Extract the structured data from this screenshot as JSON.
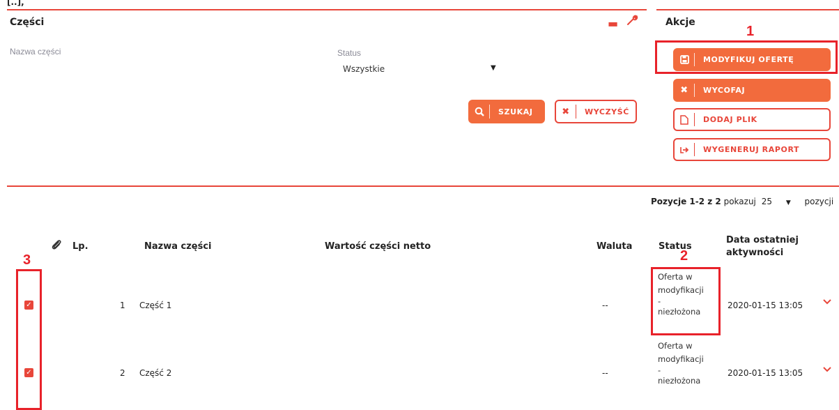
{
  "top_fragment": "[..],",
  "parts_panel": {
    "title": "Części",
    "field_name_label": "Nazwa części",
    "field_status_label": "Status",
    "status_selected": "Wszystkie",
    "search_label": "SZUKAJ",
    "clear_label": "WYCZYŚĆ"
  },
  "actions_panel": {
    "title": "Akcje",
    "buttons": [
      {
        "label": "MODYFIKUJ OFERTĘ",
        "icon": "save-icon"
      },
      {
        "label": "WYCOFAJ",
        "icon": "close-icon"
      },
      {
        "label": "DODAJ PLIK",
        "icon": "file-icon"
      },
      {
        "label": "WYGENERUJ RAPORT",
        "icon": "export-icon"
      }
    ]
  },
  "annotations": {
    "a1": "1",
    "a2": "2",
    "a3": "3"
  },
  "pagination": {
    "range_prefix": "Pozycje 1-2 z 2",
    "show_label": "pokazuj",
    "page_size": "25",
    "suffix": "pozycji"
  },
  "table": {
    "headers": {
      "lp": "Lp.",
      "name": "Nazwa części",
      "value": "Wartość części netto",
      "currency": "Waluta",
      "status": "Status",
      "date_line1": "Data ostatniej",
      "date_line2": "aktywności"
    },
    "rows": [
      {
        "lp": "1",
        "name": "Część 1",
        "currency": "--",
        "status": [
          "Oferta w",
          "modyfikacji",
          "-",
          "niezłożona"
        ],
        "date": "2020-01-15 13:05",
        "checked": true
      },
      {
        "lp": "2",
        "name": "Część 2",
        "currency": "--",
        "status": [
          "Oferta w",
          "modyfikacji",
          "-",
          "niezłożona"
        ],
        "date": "2020-01-15 13:05",
        "checked": true
      }
    ]
  },
  "colors": {
    "accent": "#e8463a",
    "annotation": "#e8222a"
  }
}
